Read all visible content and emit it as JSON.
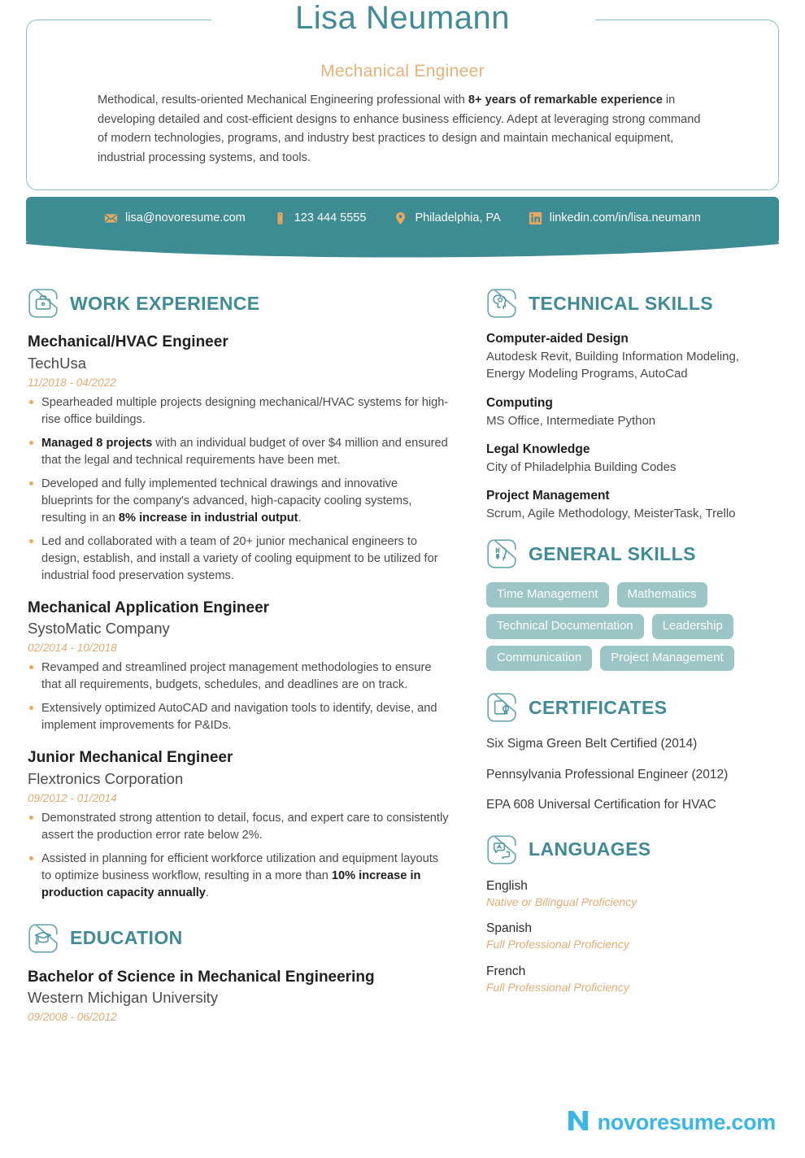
{
  "header": {
    "name": "Lisa Neumann",
    "job_title": "Mechanical Engineer",
    "summary_parts": {
      "p1": "Methodical, results-oriented Mechanical Engineering professional with ",
      "b1": "8+ years of remarkable experience",
      "p2": " in developing detailed and cost-efficient designs to enhance business efficiency. Adept at leveraging strong command of modern technologies, programs, and industry best practices to design and maintain mechanical equipment, industrial processing systems, and tools."
    }
  },
  "contact": {
    "email": "lisa@novoresume.com",
    "phone": "123 444 5555",
    "location": "Philadelphia, PA",
    "linkedin": "linkedin.com/in/lisa.neumann",
    "icons": {
      "email": "envelope-icon",
      "phone": "phone-icon",
      "location": "map-pin-icon",
      "linkedin": "linkedin-icon"
    }
  },
  "sections": {
    "work_experience": {
      "title": "WORK EXPERIENCE",
      "icon": "briefcase-icon",
      "entries": [
        {
          "role": "Mechanical/HVAC Engineer",
          "org": "TechUsa",
          "dates": "11/2018 - 04/2022",
          "bullets": [
            {
              "p1": "Spearheaded multiple projects designing mechanical/HVAC systems for high-rise office buildings.",
              "b1": "",
              "p2": ""
            },
            {
              "p1": "",
              "b1": "Managed 8 projects",
              "p2": " with an individual budget of over $4 million and ensured that the legal and technical requirements have been met."
            },
            {
              "p1": "Developed and fully implemented technical drawings and innovative blueprints for the company's advanced, high-capacity cooling systems, resulting in an ",
              "b1": "8% increase in industrial output",
              "p2": "."
            },
            {
              "p1": "Led and collaborated with a team of 20+ junior mechanical engineers to design, establish, and install a variety of cooling equipment to be utilized for industrial food preservation systems.",
              "b1": "",
              "p2": ""
            }
          ]
        },
        {
          "role": "Mechanical Application Engineer",
          "org": "SystoMatic Company",
          "dates": "02/2014 - 10/2018",
          "bullets": [
            {
              "p1": "Revamped and streamlined project management methodologies to ensure that all requirements, budgets, schedules, and deadlines are on track.",
              "b1": "",
              "p2": ""
            },
            {
              "p1": "Extensively optimized AutoCAD and navigation tools to identify, devise, and implement improvements for P&IDs.",
              "b1": "",
              "p2": ""
            }
          ]
        },
        {
          "role": "Junior Mechanical Engineer",
          "org": "Flextronics Corporation",
          "dates": "09/2012 - 01/2014",
          "bullets": [
            {
              "p1": "Demonstrated strong attention to detail, focus, and expert care to consistently assert the production error rate below 2%.",
              "b1": "",
              "p2": ""
            },
            {
              "p1": "Assisted in planning for efficient workforce utilization and equipment layouts to optimize business workflow, resulting in a more than ",
              "b1": "10% increase in production capacity annually",
              "p2": "."
            }
          ]
        }
      ]
    },
    "education": {
      "title": "EDUCATION",
      "icon": "graduation-cap-icon",
      "entries": [
        {
          "degree": "Bachelor of Science in Mechanical Engineering",
          "school": "Western Michigan University",
          "dates": "09/2008 - 06/2012"
        }
      ]
    },
    "technical_skills": {
      "title": "TECHNICAL SKILLS",
      "icon": "skills-head-icon",
      "groups": [
        {
          "name": "Computer-aided Design",
          "value": "Autodesk Revit, Building Information Modeling, Energy Modeling Programs, AutoCad"
        },
        {
          "name": "Computing",
          "value": "MS Office, Intermediate Python"
        },
        {
          "name": "Legal Knowledge",
          "value": "City of Philadelphia Building Codes"
        },
        {
          "name": "Project Management",
          "value": "Scrum, Agile Methodology, MeisterTask, Trello"
        }
      ]
    },
    "general_skills": {
      "title": "GENERAL SKILLS",
      "icon": "brain-gear-icon",
      "pills": [
        "Time Management",
        "Mathematics",
        "Technical Documentation",
        "Leadership",
        "Communication",
        "Project Management"
      ]
    },
    "certificates": {
      "title": "CERTIFICATES",
      "icon": "certificate-icon",
      "items": [
        "Six Sigma Green Belt Certified (2014)",
        "Pennsylvania Professional Engineer (2012)",
        "EPA 608 Universal Certification for HVAC"
      ]
    },
    "languages": {
      "title": "LANGUAGES",
      "icon": "translate-icon",
      "items": [
        {
          "name": "English",
          "level": "Native or Bilingual Proficiency"
        },
        {
          "name": "Spanish",
          "level": "Full Professional Proficiency"
        },
        {
          "name": "French",
          "level": "Full Professional Proficiency"
        }
      ]
    }
  },
  "footer": {
    "logo_text": "novoresume.com",
    "logo_icon": "novoresume-n-icon"
  },
  "colors": {
    "teal": "#3f8b97",
    "teal_bar": "#3d8b93",
    "orange": "#e8a95e",
    "tan": "#e8b277",
    "pill": "#9cc5c5",
    "logo_blue": "#3ab7e8"
  }
}
